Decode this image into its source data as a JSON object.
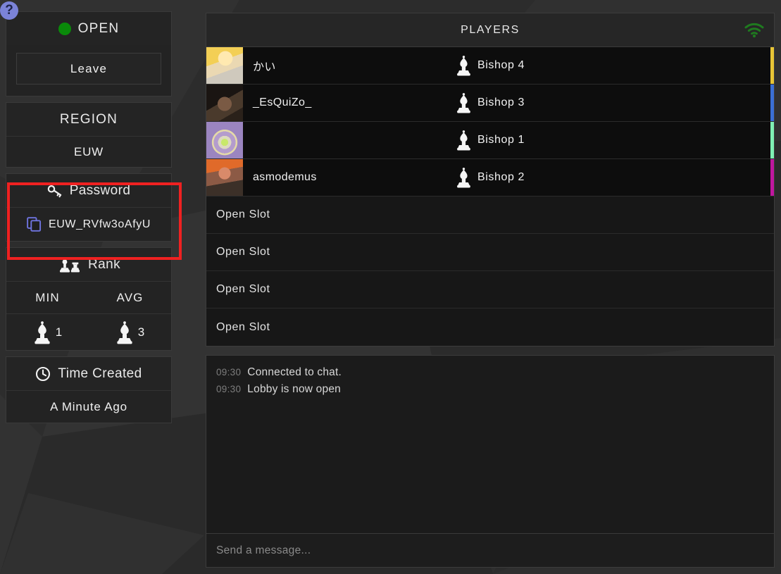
{
  "help": {
    "label": "?",
    "icon": "question-mark-icon",
    "color": "#7b83d8"
  },
  "sidebar": {
    "status": {
      "label": "OPEN",
      "dot_color": "#0a8a0a",
      "icon": "status-dot-icon"
    },
    "leave_button": {
      "label": "Leave"
    },
    "region": {
      "title": "REGION",
      "value": "EUW"
    },
    "password": {
      "title": "Password",
      "title_icon": "key-icon",
      "value": "EUW_RVfw3oAfyU",
      "copy_icon": "copy-icon",
      "copy_icon_color": "#6f74e0",
      "highlight_color": "#ef2121"
    },
    "rank": {
      "title": "Rank",
      "title_icon": "chess-pieces-icon",
      "columns": [
        "MIN",
        "AVG"
      ],
      "min": {
        "value": "1",
        "icon": "chess-bishop-icon"
      },
      "avg": {
        "value": "3",
        "icon": "chess-bishop-icon"
      }
    },
    "time_created": {
      "title": "Time Created",
      "title_icon": "clock-icon",
      "value": "A Minute Ago"
    }
  },
  "players_panel": {
    "title": "PLAYERS",
    "connection_icon": "wifi-icon",
    "connection_color": "#1f7a1f",
    "rows": [
      {
        "name": "かい",
        "rank": "Bishop 4",
        "rank_icon": "chess-bishop-icon",
        "stripe": "#e8c536",
        "avatar": "anime-blonde-avatar"
      },
      {
        "name": "_EsQuiZo_",
        "rank": "Bishop 3",
        "rank_icon": "chess-bishop-icon",
        "stripe": "#3b6fd4",
        "avatar": "horror-face-avatar"
      },
      {
        "name": "",
        "rank": "Bishop 1",
        "rank_icon": "chess-bishop-icon",
        "stripe": "#7ff0b4",
        "avatar": "purple-orb-avatar"
      },
      {
        "name": "asmodemus",
        "rank": "Bishop 2",
        "rank_icon": "chess-bishop-icon",
        "stripe": "#c0179f",
        "avatar": "redhead-avatar"
      }
    ],
    "open_slots": [
      "Open Slot",
      "Open Slot",
      "Open Slot",
      "Open Slot"
    ]
  },
  "chat": {
    "messages": [
      {
        "time": "09:30",
        "text": "Connected to chat."
      },
      {
        "time": "09:30",
        "text": "Lobby is now open"
      }
    ],
    "input_placeholder": "Send a message...",
    "input_value": ""
  }
}
